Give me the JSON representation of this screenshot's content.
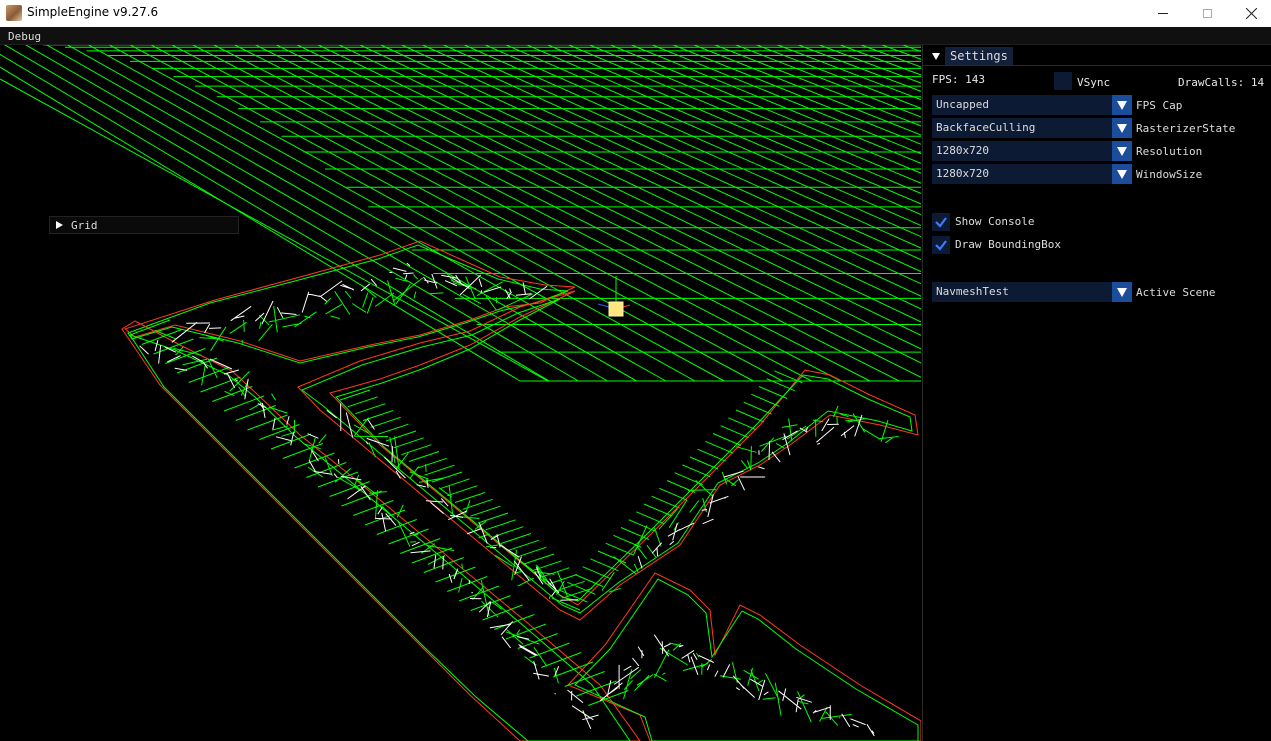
{
  "window": {
    "title": "SimpleEngine v9.27.6",
    "icon": "app-icon"
  },
  "menu": {
    "items": [
      "Debug"
    ]
  },
  "grid_window": {
    "label": "Grid"
  },
  "settings": {
    "title": "Settings",
    "fps_text": "FPS: 143",
    "vsync_label": "VSync",
    "vsync_checked": false,
    "drawcalls_text": "DrawCalls: 14",
    "combos": [
      {
        "value": "Uncapped",
        "label": "FPS Cap"
      },
      {
        "value": "BackfaceCulling",
        "label": "RasterizerState"
      },
      {
        "value": "1280x720",
        "label": "Resolution"
      },
      {
        "value": "1280x720",
        "label": "WindowSize"
      }
    ],
    "checks": [
      {
        "label": "Show Console",
        "checked": true
      },
      {
        "label": "Draw BoundingBox",
        "checked": true
      }
    ],
    "scene": {
      "value": "NavmeshTest",
      "label": "Active Scene"
    }
  },
  "colors": {
    "grid": "#00ff00",
    "navmesh_edge": "#ffffff",
    "navmesh_border": "#ff3b1e",
    "accent": "#1b4d9a",
    "frame_bg": "#0c1a33",
    "check": "#3a7bff",
    "camera_light": "#ffe680"
  }
}
